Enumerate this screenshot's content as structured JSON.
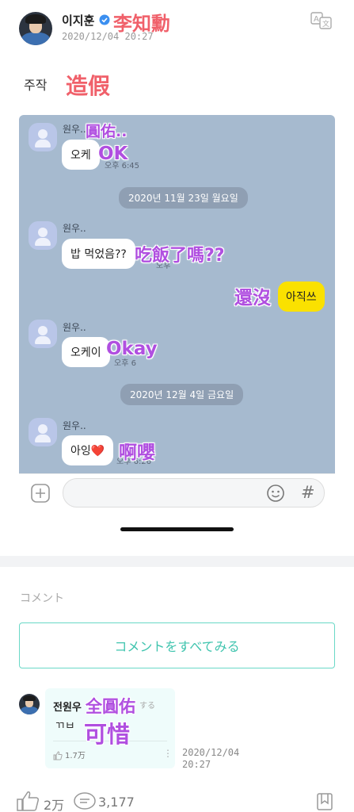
{
  "post": {
    "author": "이지훈",
    "author_overlay": "李知勳",
    "date": "2020/12/04 20:27",
    "body": "주작",
    "body_overlay": "造假"
  },
  "chat": {
    "sender": "원우..",
    "sender_overlay": "圓佑..",
    "messages": [
      {
        "text": "오케",
        "overlay": "OK",
        "time": "오후 6:45"
      },
      {
        "text": "밥 먹었음??",
        "overlay": "吃飯了嗎??",
        "time": "오후"
      },
      {
        "text": "아직쓰",
        "overlay": "還沒",
        "time": "오후"
      },
      {
        "text": "오케이",
        "overlay": "Okay",
        "time": "오후 6"
      },
      {
        "text": "아잉❤️",
        "overlay": "啊嚶",
        "time": "오후 6:26"
      }
    ],
    "date_dividers": [
      "2020년 11월 23일 월요일",
      "2020년 12월 4일 금요일"
    ],
    "input_placeholder": "",
    "hash_symbol": "#"
  },
  "comments": {
    "section_title": "コメント",
    "all_button": "コメントをすべてみる",
    "items": [
      {
        "name": "전원우",
        "name_overlay": "全圓佑",
        "suffix": "する",
        "text": "ㄲㅂ",
        "text_overlay": "可惜",
        "likes": "1.7万",
        "date_line1": "2020/12/04",
        "date_line2": "20:27"
      }
    ]
  },
  "stats": {
    "likes": "2万",
    "comments": "3,177"
  },
  "icons": {
    "translate": "translate-icon",
    "verified": "verified-badge-icon",
    "plus": "plus-square-icon",
    "emoji": "emoji-icon",
    "like": "like-hand-icon",
    "comment": "comment-bubble-icon",
    "bookmark": "bookmark-icon",
    "more": "more-vertical-icon"
  },
  "colors": {
    "chat_bg": "#a6bacf",
    "accent_teal": "#3fc4ae",
    "overlay_red": "#f0606a",
    "overlay_purple": "#b04fe0",
    "kakao_yellow": "#fae100"
  }
}
